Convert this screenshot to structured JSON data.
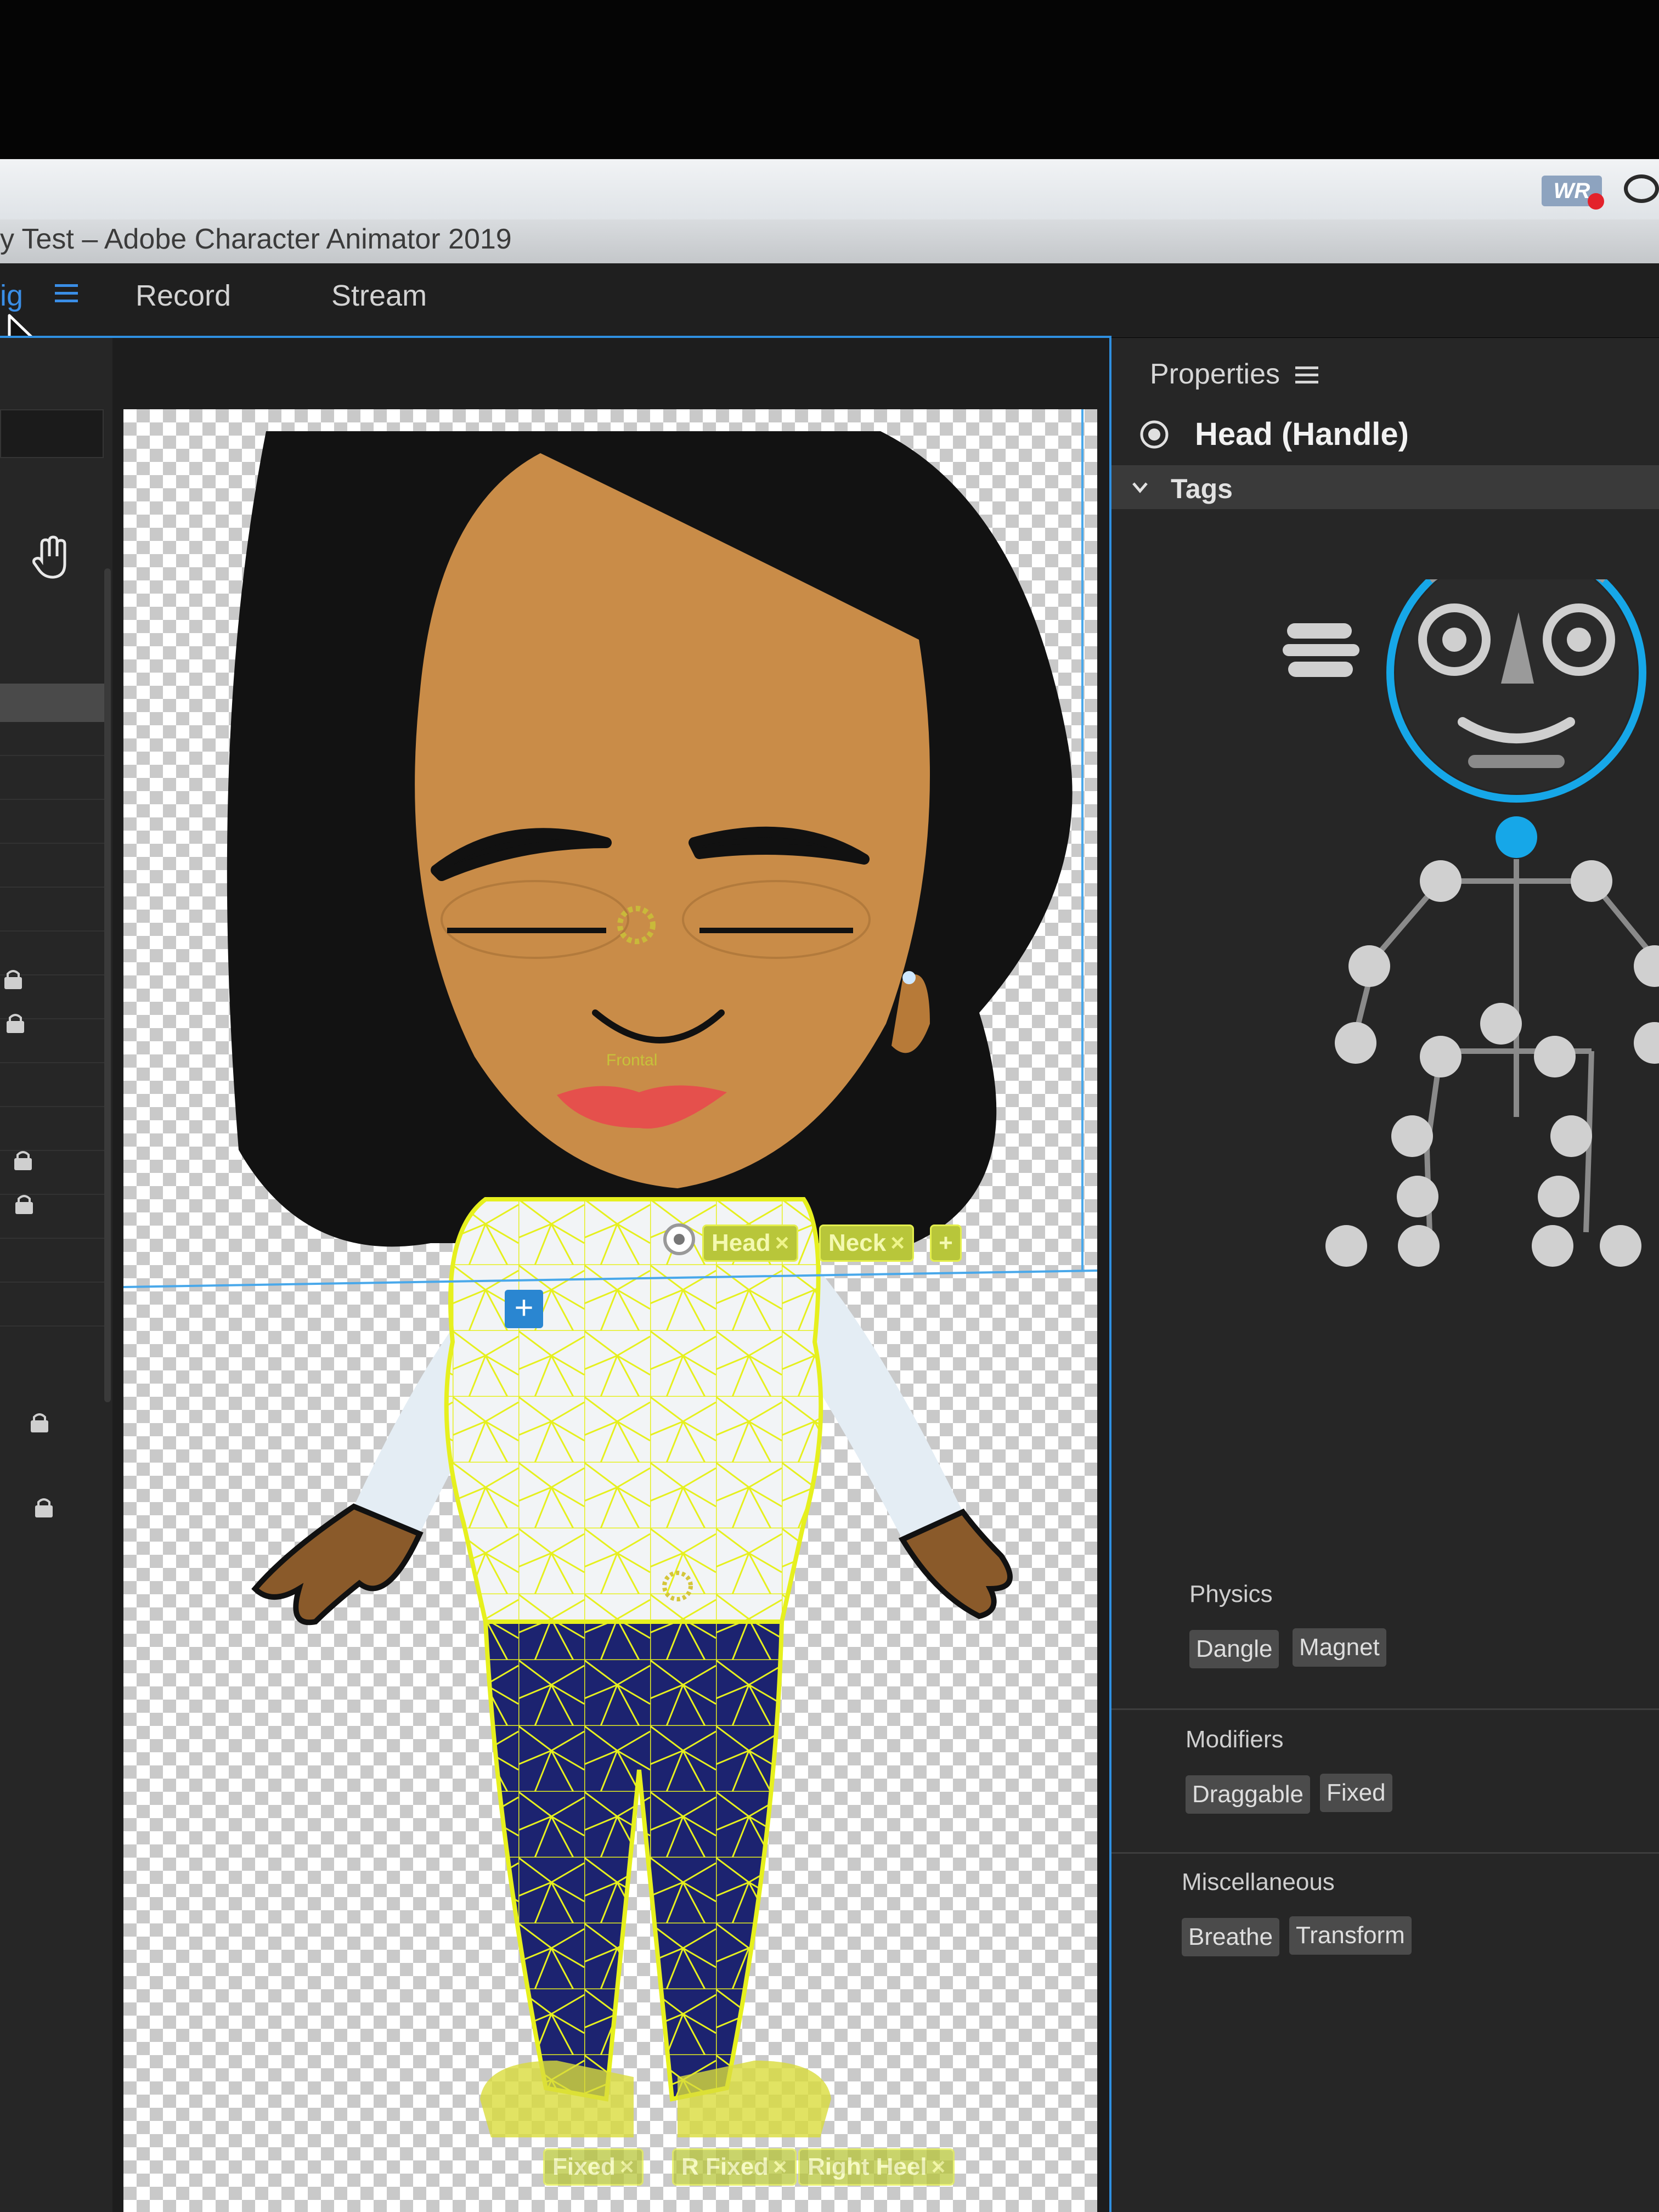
{
  "window": {
    "title": "y Test – Adobe Character Animator 2019"
  },
  "menubar": {
    "recording_icon_label": "WR",
    "icons": [
      "recording-icon",
      "creative-cloud-icon"
    ]
  },
  "workspaces": {
    "rig": "ig",
    "record": "Record",
    "stream": "Stream",
    "active": "Rig",
    "accent_color": "#3a8ee6"
  },
  "scene": {
    "handle_labels": {
      "frontal": "Frontal"
    },
    "neck_chip_tags": [
      {
        "label": "Head",
        "remove": "×"
      },
      {
        "label": "Neck",
        "remove": "×"
      }
    ],
    "add_tag": "+",
    "foot_chip_tags": [
      {
        "label": "Fixed",
        "remove": "×"
      },
      {
        "label": "R Fixed",
        "remove": "×"
      },
      {
        "label": "Right Heel",
        "remove": "×"
      }
    ],
    "add_handle": "+",
    "mesh_color": "#e6f01e"
  },
  "properties": {
    "title": "Properties",
    "selected_name": "Head (Handle)",
    "tags_section": "Tags",
    "highlight_color": "#16a7e8",
    "groups": [
      {
        "title": "Physics",
        "tags": [
          "Dangle",
          "Magnet"
        ]
      },
      {
        "title": "Modifiers",
        "tags": [
          "Draggable",
          "Fixed"
        ]
      },
      {
        "title": "Miscellaneous",
        "tags": [
          "Breathe",
          "Transform"
        ]
      }
    ]
  }
}
